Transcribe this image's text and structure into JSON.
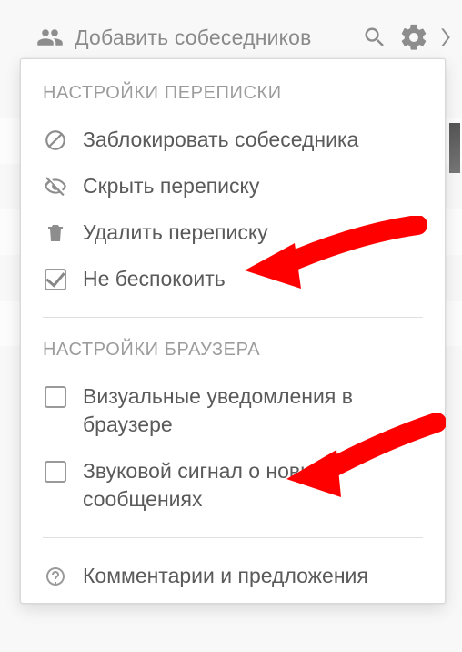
{
  "topbar": {
    "add_label": "Добавить собеседников"
  },
  "panel": {
    "section1_title": "НАСТРОЙКИ ПЕРЕПИСКИ",
    "block_label": "Заблокировать собеседника",
    "hide_label": "Скрыть переписку",
    "delete_label": "Удалить переписку",
    "dnd_label": "Не беспокоить",
    "section2_title": "НАСТРОЙКИ БРАУЗЕРА",
    "visual_label": "Визуальные уведомления в браузере",
    "sound_label": "Звуковой сигнал о новых сообщениях",
    "feedback_label": "Комментарии и предложения"
  },
  "colors": {
    "arrow": "#ff0000",
    "icon": "#8d8d8d",
    "text": "#5a5a5a",
    "muted": "#9c9c9c"
  }
}
